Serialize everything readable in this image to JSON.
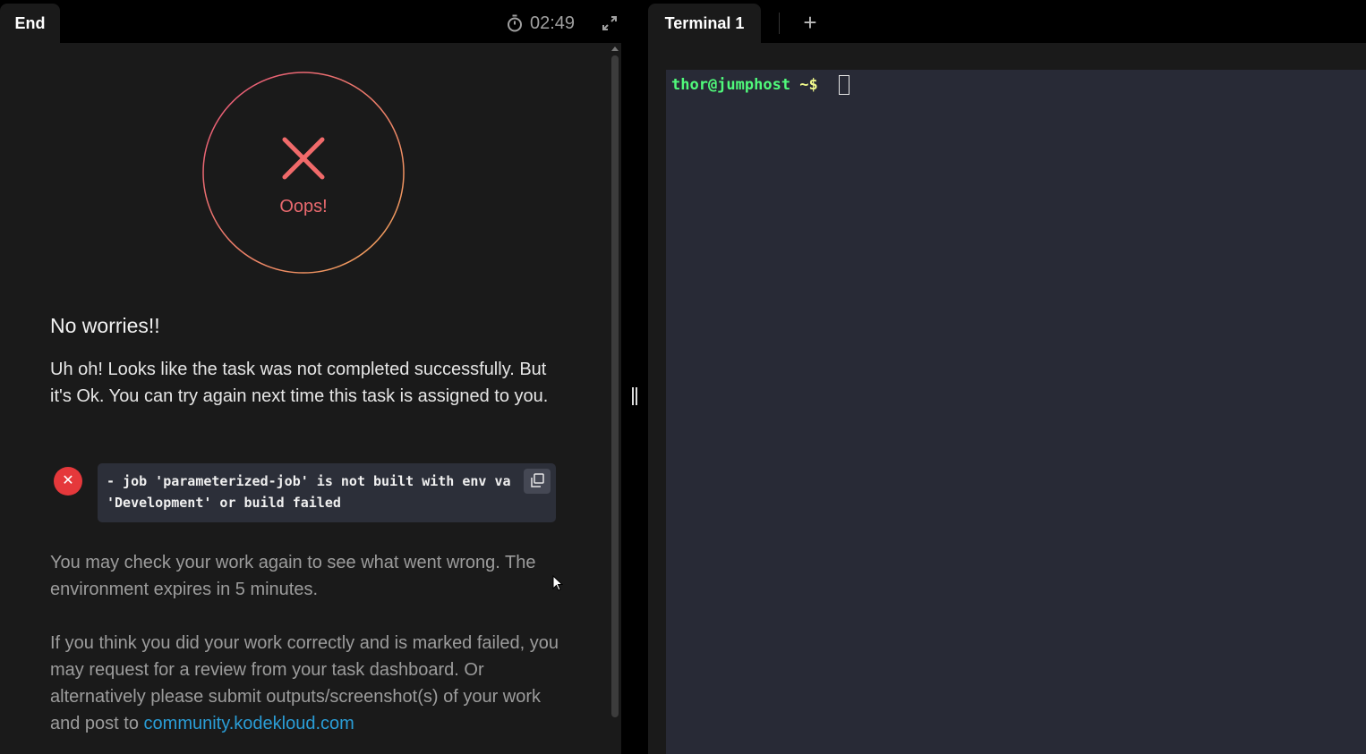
{
  "left_tab": {
    "label": "End"
  },
  "timer": {
    "value": "02:49",
    "icon": "stopwatch-icon"
  },
  "result": {
    "badge_text": "Oops!",
    "heading": "No worries!!",
    "message": "Uh oh! Looks like the task was not completed successfully. But it's Ok. You can try again next time this task is assigned to you.",
    "error": "- job 'parameterized-job' is not built with env va 'Development' or build failed",
    "check_text": "You may check your work again to see what went wrong. The environment expires in 5 minutes.",
    "review_text": "If you think you did your work correctly and is marked failed, you may request for a review from your task dashboard. Or alternatively please submit outputs/screenshot(s) of your work and post to",
    "link_text": "community.kodekloud.com"
  },
  "terminal": {
    "tab_label": "Terminal 1",
    "prompt_user": "thor@jumphost",
    "prompt_path": " ~$"
  },
  "colors": {
    "error_red": "#e5383b",
    "oops_text": "#e8696e",
    "link": "#2a9dd6",
    "prompt_user": "#50fa7b",
    "prompt_path": "#f1fa8c",
    "terminal_bg": "#282a36"
  }
}
